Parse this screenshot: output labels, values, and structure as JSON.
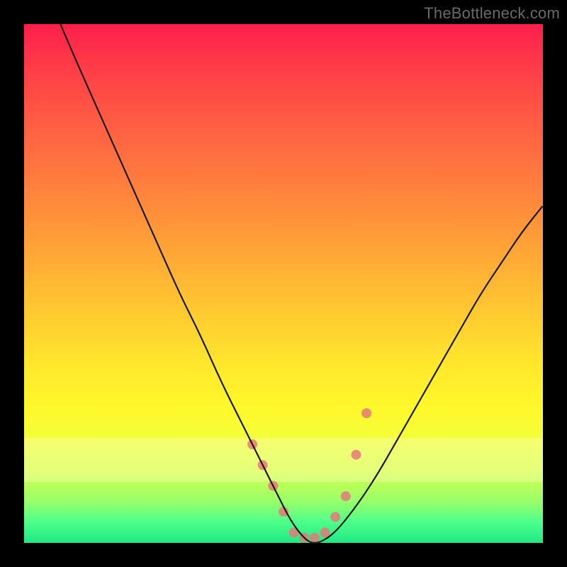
{
  "watermark": "TheBottleneck.com",
  "chart_data": {
    "type": "line",
    "title": "",
    "xlabel": "",
    "ylabel": "",
    "xlim": [
      0,
      100
    ],
    "ylim": [
      0,
      100
    ],
    "grid": false,
    "series": [
      {
        "name": "curve",
        "x": [
          7,
          10,
          14,
          18,
          22,
          26,
          30,
          34,
          38,
          42,
          46,
          49,
          51,
          53,
          55,
          57,
          60,
          64,
          68,
          72,
          76,
          80,
          84,
          88,
          92,
          96,
          100
        ],
        "y": [
          100,
          93,
          84,
          75,
          66,
          57,
          48,
          40,
          31,
          23,
          15,
          9,
          5,
          2,
          0,
          0,
          2,
          7,
          13,
          20,
          27,
          34,
          41,
          48,
          54,
          60,
          65
        ]
      }
    ],
    "markers": {
      "name": "salmon-dots",
      "x": [
        44,
        46,
        48,
        50,
        52,
        54,
        56,
        58,
        60,
        62,
        64,
        66
      ],
      "y": [
        19,
        15,
        11,
        6,
        2,
        1,
        1,
        2,
        5,
        9,
        17,
        25
      ],
      "color": "#e47a7a",
      "size": 14
    }
  },
  "colors": {
    "curve": "#1a1a1a",
    "marker": "#e47a7a"
  }
}
